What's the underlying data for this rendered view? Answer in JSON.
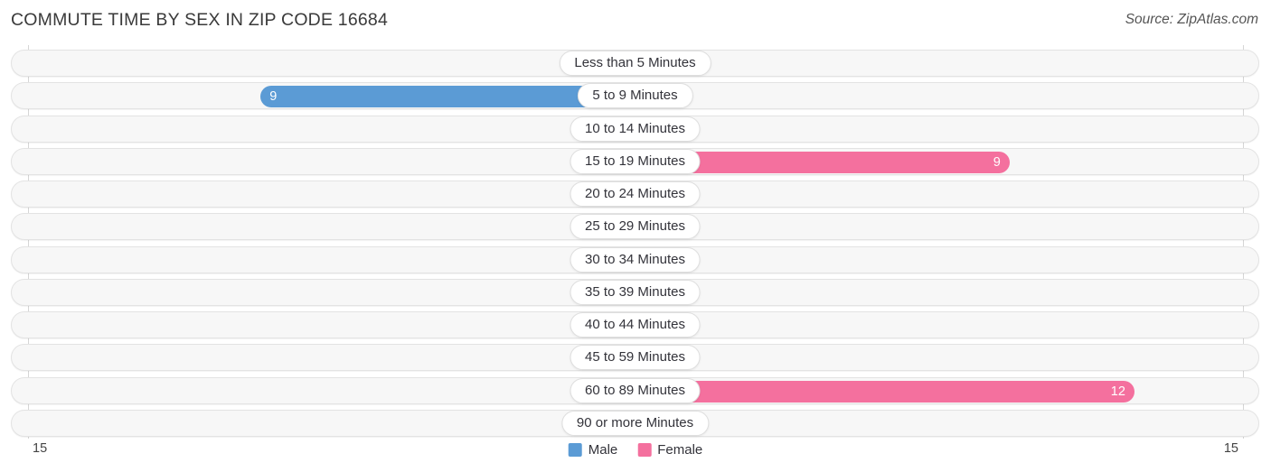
{
  "header": {
    "title": "COMMUTE TIME BY SEX IN ZIP CODE 16684",
    "source": "Source: ZipAtlas.com"
  },
  "footer": {
    "axis_left": "15",
    "axis_right": "15"
  },
  "legend": {
    "items": [
      {
        "label": "Male",
        "color": "#5b9bd5"
      },
      {
        "label": "Female",
        "color": "#f4709e"
      }
    ]
  },
  "colors": {
    "male": "#5b9bd5",
    "male_zero": "#b3cdee",
    "female": "#f4709e",
    "female_zero": "#f9b5cd",
    "track": "#f7f7f7",
    "track_border": "#e3e3e3"
  },
  "chart_data": {
    "type": "bar",
    "subtype": "diverging-horizontal",
    "title": "COMMUTE TIME BY SEX IN ZIP CODE 16684",
    "xlabel": "",
    "ylabel": "",
    "xlim": [
      15,
      15
    ],
    "axis_max_per_side": 15,
    "grid": false,
    "legend_position": "bottom-center",
    "categories": [
      "Less than 5 Minutes",
      "5 to 9 Minutes",
      "10 to 14 Minutes",
      "15 to 19 Minutes",
      "20 to 24 Minutes",
      "25 to 29 Minutes",
      "30 to 34 Minutes",
      "35 to 39 Minutes",
      "40 to 44 Minutes",
      "45 to 59 Minutes",
      "60 to 89 Minutes",
      "90 or more Minutes"
    ],
    "series": [
      {
        "name": "Male",
        "color": "#5b9bd5",
        "direction": "left",
        "values": [
          0,
          9,
          0,
          0,
          0,
          0,
          0,
          0,
          0,
          0,
          0,
          0
        ],
        "labels": [
          "0",
          "9",
          "0",
          "0",
          "0",
          "0",
          "0",
          "0",
          "0",
          "0",
          "0",
          "0"
        ]
      },
      {
        "name": "Female",
        "color": "#f4709e",
        "direction": "right",
        "values": [
          0,
          0,
          0,
          9,
          0,
          0,
          0,
          0,
          0,
          0,
          12,
          0
        ],
        "labels": [
          "0",
          "0",
          "0",
          "9",
          "0",
          "0",
          "0",
          "0",
          "0",
          "0",
          "12",
          "0"
        ]
      }
    ]
  }
}
